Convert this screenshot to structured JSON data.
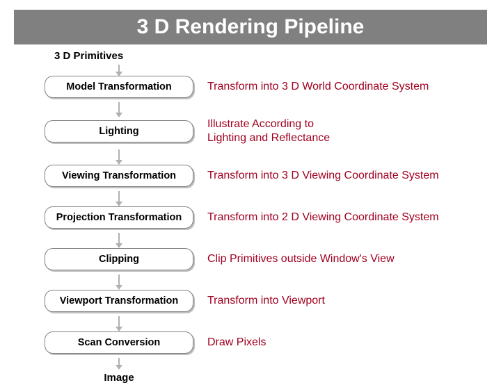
{
  "title": "3 D Rendering Pipeline",
  "input_label": "3 D Primitives",
  "output_label": "Image",
  "stages": [
    {
      "name": "Model Transformation",
      "desc": "Transform into 3 D World Coordinate System"
    },
    {
      "name": "Lighting",
      "desc": "Illustrate According to\nLighting and Reflectance"
    },
    {
      "name": "Viewing Transformation",
      "desc": "Transform into 3 D Viewing Coordinate System"
    },
    {
      "name": "Projection Transformation",
      "desc": "Transform into 2 D Viewing Coordinate System"
    },
    {
      "name": "Clipping",
      "desc": "Clip Primitives outside Window's View"
    },
    {
      "name": "Viewport Transformation",
      "desc": "Transform into Viewport"
    },
    {
      "name": "Scan Conversion",
      "desc": "Draw Pixels"
    }
  ]
}
